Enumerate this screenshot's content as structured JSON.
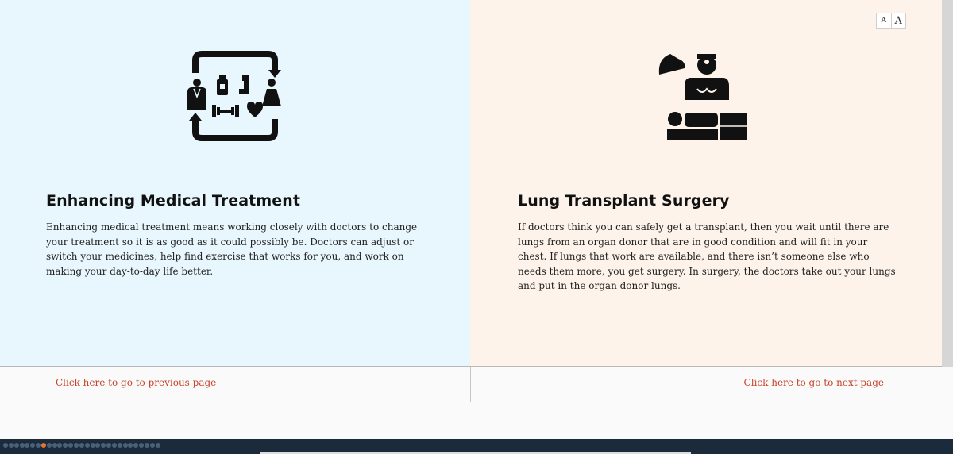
{
  "font_controls": {
    "small_label": "A",
    "large_label": "A"
  },
  "left_panel": {
    "icon": "medical-care-cycle-icon",
    "title": "Enhancing Medical Treatment",
    "body": "Enhancing medical treatment means working closely with doctors to change your treatment so it is as good as it could possibly be. Doctors can adjust or switch your medicines, help find exercise that works for you, and work on making your day-to-day life better."
  },
  "right_panel": {
    "icon": "surgeon-operating-icon",
    "title": "Lung Transplant Surgery",
    "body": "If doctors think you can safely get a transplant, then you wait until there are lungs from an organ donor that are in good condition and will fit in your chest. If lungs that work are available, and there isn’t someone else who needs them more, you get surgery. In surgery, the doctors take out your lungs and put in the organ donor lungs."
  },
  "navigation": {
    "previous_label": "Click here to go to previous page",
    "next_label": "Click here to go to next page"
  },
  "progress": {
    "total_pages": 29,
    "current_page": 8
  },
  "colors": {
    "left_panel_bg": "#e8f7fd",
    "right_panel_bg": "#fdf3ea",
    "link": "#c8442a",
    "progress_active": "#e8742e",
    "progress_inactive": "#4a6077",
    "bottom_bar": "#1b2b3b"
  }
}
